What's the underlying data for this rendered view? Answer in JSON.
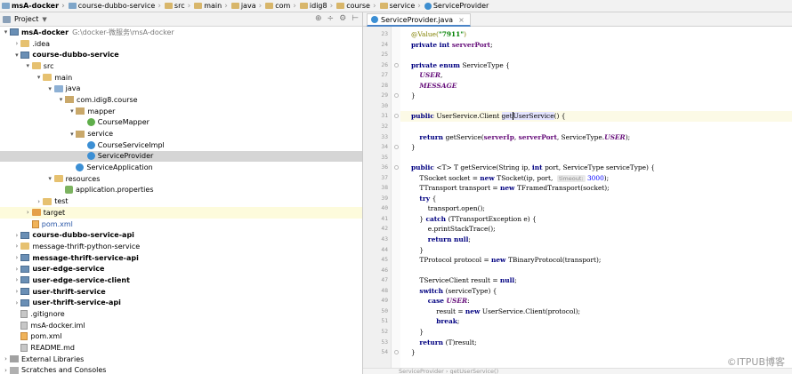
{
  "breadcrumb": [
    "msA-docker",
    "course-dubbo-service",
    "src",
    "main",
    "java",
    "com",
    "idig8",
    "course",
    "service",
    "ServiceProvider"
  ],
  "project_panel": {
    "title": "Project",
    "dropdown": "▼",
    "tools": [
      "⊕",
      "÷",
      "⚙",
      "⊢"
    ]
  },
  "tree": [
    {
      "label": "msA-docker",
      "hint": "G:\\docker-微服务\\msA-docker",
      "indent": 0,
      "arrow": "▾",
      "icon": "mod",
      "bold": true
    },
    {
      "label": ".idea",
      "indent": 1,
      "arrow": "›",
      "icon": "folder"
    },
    {
      "label": "course-dubbo-service",
      "indent": 1,
      "arrow": "▾",
      "icon": "mod",
      "bold": true
    },
    {
      "label": "src",
      "indent": 2,
      "arrow": "▾",
      "icon": "folder"
    },
    {
      "label": "main",
      "indent": 3,
      "arrow": "▾",
      "icon": "folder"
    },
    {
      "label": "java",
      "indent": 4,
      "arrow": "▾",
      "icon": "folder blue"
    },
    {
      "label": "com.idig8.course",
      "indent": 5,
      "arrow": "▾",
      "icon": "pkg"
    },
    {
      "label": "mapper",
      "indent": 6,
      "arrow": "▾",
      "icon": "pkg"
    },
    {
      "label": "CourseMapper",
      "indent": 7,
      "arrow": "",
      "icon": "intf"
    },
    {
      "label": "service",
      "indent": 6,
      "arrow": "▾",
      "icon": "pkg"
    },
    {
      "label": "CourseServiceImpl",
      "indent": 7,
      "arrow": "",
      "icon": "cls"
    },
    {
      "label": "ServiceProvider",
      "indent": 7,
      "arrow": "",
      "icon": "cls",
      "selected": true
    },
    {
      "label": "ServiceApplication",
      "indent": 6,
      "arrow": "",
      "icon": "cls"
    },
    {
      "label": "resources",
      "indent": 4,
      "arrow": "▾",
      "icon": "folder"
    },
    {
      "label": "application.properties",
      "indent": 5,
      "arrow": "",
      "icon": "prop"
    },
    {
      "label": "test",
      "indent": 3,
      "arrow": "›",
      "icon": "folder"
    },
    {
      "label": "target",
      "indent": 2,
      "arrow": "›",
      "icon": "folder orange",
      "highlight": true
    },
    {
      "label": "pom.xml",
      "indent": 2,
      "arrow": "",
      "icon": "xml",
      "blue": true
    },
    {
      "label": "course-dubbo-service-api",
      "indent": 1,
      "arrow": "›",
      "icon": "mod",
      "bold": true
    },
    {
      "label": "message-thrift-python-service",
      "indent": 1,
      "arrow": "›",
      "icon": "folder"
    },
    {
      "label": "message-thrift-service-api",
      "indent": 1,
      "arrow": "›",
      "icon": "mod",
      "bold": true
    },
    {
      "label": "user-edge-service",
      "indent": 1,
      "arrow": "›",
      "icon": "mod",
      "bold": true
    },
    {
      "label": "user-edge-service-client",
      "indent": 1,
      "arrow": "›",
      "icon": "mod",
      "bold": true
    },
    {
      "label": "user-thrift-service",
      "indent": 1,
      "arrow": "›",
      "icon": "mod",
      "bold": true
    },
    {
      "label": "user-thrift-service-api",
      "indent": 1,
      "arrow": "›",
      "icon": "mod",
      "bold": true
    },
    {
      "label": ".gitignore",
      "indent": 1,
      "arrow": "",
      "icon": "file"
    },
    {
      "label": "msA-docker.iml",
      "indent": 1,
      "arrow": "",
      "icon": "file"
    },
    {
      "label": "pom.xml",
      "indent": 1,
      "arrow": "",
      "icon": "xml"
    },
    {
      "label": "README.md",
      "indent": 1,
      "arrow": "",
      "icon": "file"
    },
    {
      "label": "External Libraries",
      "indent": 0,
      "arrow": "›",
      "icon": "lib"
    },
    {
      "label": "Scratches and Consoles",
      "indent": 0,
      "arrow": "›",
      "icon": "scr"
    }
  ],
  "editor": {
    "tab_label": "ServiceProvider.java",
    "tab_close": "×",
    "lines": [
      {
        "n": "23",
        "html": "<span class=\"ann\">@Value(</span><span class=\"str\">\"7911\"</span><span class=\"ann\">)</span>"
      },
      {
        "n": "24",
        "html": "<span class=\"kw\">private int </span><span class=\"fld\">serverPort</span>;"
      },
      {
        "n": "25",
        "html": ""
      },
      {
        "n": "26",
        "html": "<span class=\"kw\">private enum </span>ServiceType {"
      },
      {
        "n": "27",
        "html": "    <span class=\"fldi\">USER</span>,"
      },
      {
        "n": "28",
        "html": "    <span class=\"fldi\">MESSAGE</span>"
      },
      {
        "n": "29",
        "html": "}"
      },
      {
        "n": "30",
        "html": ""
      },
      {
        "n": "31",
        "html": "<span class=\"kw\">public </span>UserService.Client <span class=\"hi\">get<span class=\"caret\"></span>UserService</span>() {",
        "current": true
      },
      {
        "n": "32",
        "html": ""
      },
      {
        "n": "33",
        "html": "    <span class=\"kw\">return </span>getService(<span class=\"fld\">serverIp</span>, <span class=\"fld\">serverPort</span>, ServiceType.<span class=\"fldi\">USER</span>);"
      },
      {
        "n": "34",
        "html": "}"
      },
      {
        "n": "35",
        "html": ""
      },
      {
        "n": "36",
        "html": "<span class=\"kw\">public </span>&lt;T&gt; T getService(String ip, <span class=\"kw\">int </span>port, ServiceType serviceType) {"
      },
      {
        "n": "37",
        "html": "    TSocket socket = <span class=\"kw\">new </span>TSocket(ip, port,  <span class=\"hintbox\">timeout:</span> <span class=\"num\">3000</span>);"
      },
      {
        "n": "38",
        "html": "    TTransport transport = <span class=\"kw\">new </span>TFramedTransport(socket);"
      },
      {
        "n": "39",
        "html": "    <span class=\"kw\">try </span>{"
      },
      {
        "n": "40",
        "html": "        transport.open();"
      },
      {
        "n": "41",
        "html": "    } <span class=\"kw\">catch </span>(TTransportException e) {"
      },
      {
        "n": "42",
        "html": "        e.printStackTrace();"
      },
      {
        "n": "43",
        "html": "        <span class=\"kw\">return null</span>;"
      },
      {
        "n": "44",
        "html": "    }"
      },
      {
        "n": "45",
        "html": "    TProtocol protocol = <span class=\"kw\">new </span>TBinaryProtocol(transport);"
      },
      {
        "n": "46",
        "html": ""
      },
      {
        "n": "47",
        "html": "    TServiceClient result = <span class=\"kw\">null</span>;"
      },
      {
        "n": "48",
        "html": "    <span class=\"kw\">switch </span>(serviceType) {"
      },
      {
        "n": "49",
        "html": "        <span class=\"kw\">case </span><span class=\"fldi\">USER</span>:"
      },
      {
        "n": "50",
        "html": "            result = <span class=\"kw\">new </span>UserService.Client(protocol);"
      },
      {
        "n": "51",
        "html": "            <span class=\"kw\">break</span>;"
      },
      {
        "n": "52",
        "html": "    }"
      },
      {
        "n": "53",
        "html": "    <span class=\"kw\">return </span>(T)result;"
      },
      {
        "n": "54",
        "html": "}"
      }
    ],
    "status": "ServiceProvider  ›  getUserService()"
  },
  "watermark": "©ITPUB博客"
}
